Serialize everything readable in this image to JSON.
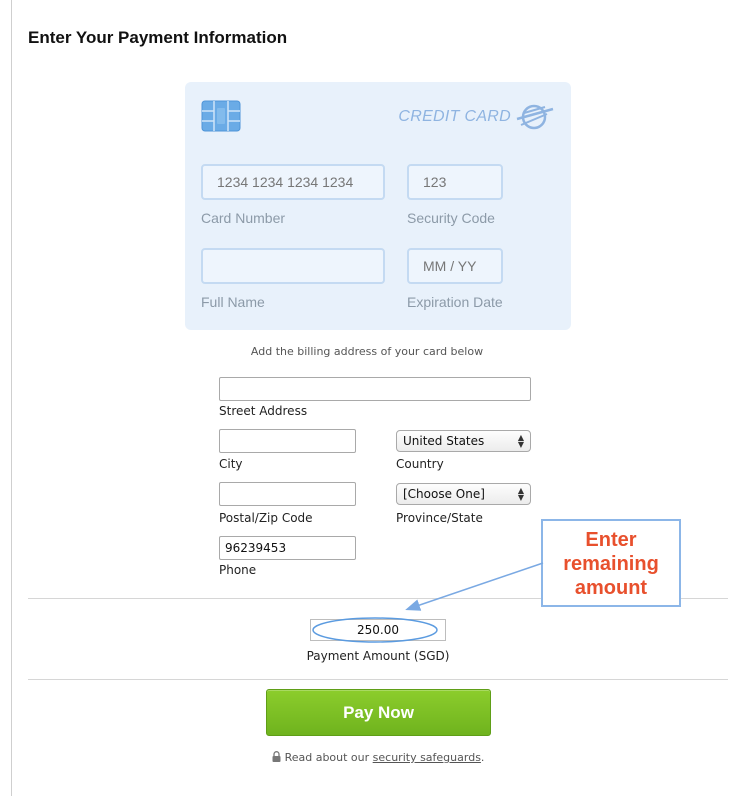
{
  "page": {
    "title": "Enter Your Payment Information"
  },
  "card": {
    "brand_label": "CREDIT CARD",
    "card_number": {
      "placeholder": "1234 1234 1234 1234",
      "label": "Card Number"
    },
    "security_code": {
      "placeholder": "123",
      "label": "Security Code"
    },
    "full_name": {
      "placeholder": "",
      "label": "Full Name"
    },
    "expiration": {
      "placeholder": "MM / YY",
      "label": "Expiration Date"
    }
  },
  "billing": {
    "note": "Add the billing address of your card below",
    "street": {
      "value": "",
      "label": "Street Address"
    },
    "city": {
      "value": "",
      "label": "City"
    },
    "country": {
      "selected": "United States",
      "label": "Country"
    },
    "postal": {
      "value": "",
      "label": "Postal/Zip Code"
    },
    "province": {
      "selected": "[Choose One]",
      "label": "Province/State"
    },
    "phone": {
      "value": "96239453",
      "label": "Phone"
    }
  },
  "payment": {
    "amount": "250.00",
    "label": "Payment Amount (SGD)",
    "pay_button": "Pay Now",
    "safeguards_prefix": "Read about our ",
    "safeguards_link": "security safeguards",
    "safeguards_suffix": "."
  },
  "annotation": {
    "line1": "Enter",
    "line2": "remaining",
    "line3": "amount"
  },
  "colors": {
    "card_bg": "#e8f1fb",
    "card_field_border": "#c4daf2",
    "pay_button": "#7cc027",
    "callout_text": "#e8502d",
    "callout_border": "#8cb6e8"
  }
}
